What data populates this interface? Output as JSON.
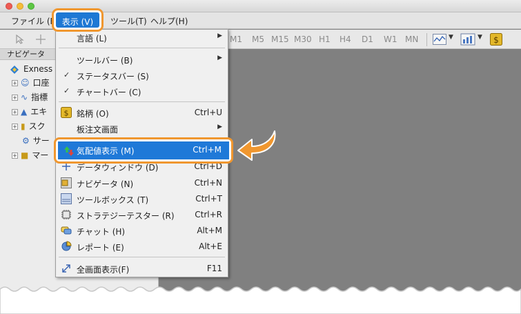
{
  "menubar": {
    "file": "ファイル (F)",
    "view": "表示 (V)",
    "tools": "ツール(T)",
    "help": "ヘルプ(H)"
  },
  "toolbar": {
    "timeframes": [
      "M1",
      "M5",
      "M15",
      "M30",
      "H1",
      "H4",
      "D1",
      "W1",
      "MN"
    ]
  },
  "navigator": {
    "title": "ナビゲータ",
    "root": "Exness",
    "items": [
      "口座",
      "指標",
      "エキ",
      "スク",
      "サー",
      "マー"
    ]
  },
  "view_menu": {
    "items": [
      {
        "label": "言語 (L)",
        "shortcut": "",
        "submenu": true,
        "checked": false,
        "icon": ""
      },
      {
        "label": "ツールバー (B)",
        "shortcut": "",
        "submenu": true,
        "checked": false,
        "icon": ""
      },
      {
        "label": "ステータスバー (S)",
        "shortcut": "",
        "submenu": false,
        "checked": true,
        "icon": ""
      },
      {
        "label": "チャートバー (C)",
        "shortcut": "",
        "submenu": false,
        "checked": true,
        "icon": ""
      },
      {
        "label": "銘柄 (O)",
        "shortcut": "Ctrl+U",
        "submenu": false,
        "checked": false,
        "icon": "dollar-icon"
      },
      {
        "label": "板注文画面",
        "shortcut": "",
        "submenu": true,
        "checked": false,
        "icon": ""
      },
      {
        "label": "気配値表示 (M)",
        "shortcut": "Ctrl+M",
        "submenu": false,
        "checked": false,
        "icon": "market-watch-icon",
        "selected": true
      },
      {
        "label": "データウィンドウ (D)",
        "shortcut": "Ctrl+D",
        "submenu": false,
        "checked": false,
        "icon": "crosshair-icon"
      },
      {
        "label": "ナビゲータ (N)",
        "shortcut": "Ctrl+N",
        "submenu": false,
        "checked": false,
        "icon": "navigator-icon"
      },
      {
        "label": "ツールボックス (T)",
        "shortcut": "Ctrl+T",
        "submenu": false,
        "checked": false,
        "icon": "toolbox-icon"
      },
      {
        "label": "ストラテジーテスター (R)",
        "shortcut": "Ctrl+R",
        "submenu": false,
        "checked": false,
        "icon": "tester-icon"
      },
      {
        "label": "チャット (H)",
        "shortcut": "Alt+M",
        "submenu": false,
        "checked": false,
        "icon": "chat-icon"
      },
      {
        "label": "レポート (E)",
        "shortcut": "Alt+E",
        "submenu": false,
        "checked": false,
        "icon": "report-icon"
      },
      {
        "label": "全画面表示(F)",
        "shortcut": "F11",
        "submenu": false,
        "checked": false,
        "icon": "fullscreen-icon"
      }
    ]
  },
  "colors": {
    "highlight": "#1e78d4",
    "callout": "#f0972f"
  }
}
